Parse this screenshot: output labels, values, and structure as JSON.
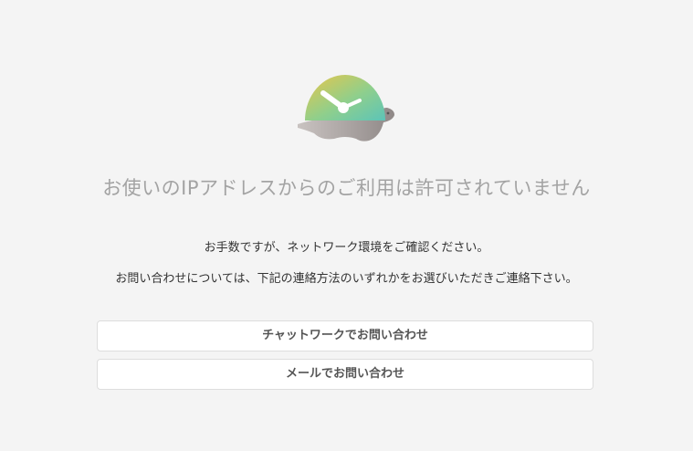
{
  "error": {
    "title": "お使いのIPアドレスからのご利用は許可されていません",
    "message_line1": "お手数ですが、ネットワーク環境をご確認ください。",
    "message_line2": "お問い合わせについては、下記の連絡方法のいずれかをお選びいただきご連絡下さい。"
  },
  "buttons": {
    "chatwork_label": "チャットワークでお問い合わせ",
    "mail_label": "メールでお問い合わせ"
  },
  "icons": {
    "logo": "turtle-clock-icon"
  },
  "colors": {
    "background": "#f4f4f4",
    "title_text": "#a3a3a3",
    "shell_gradient_start": "#e8c64a",
    "shell_gradient_end": "#5cc4b8",
    "turtle_body": "#9e9796"
  }
}
